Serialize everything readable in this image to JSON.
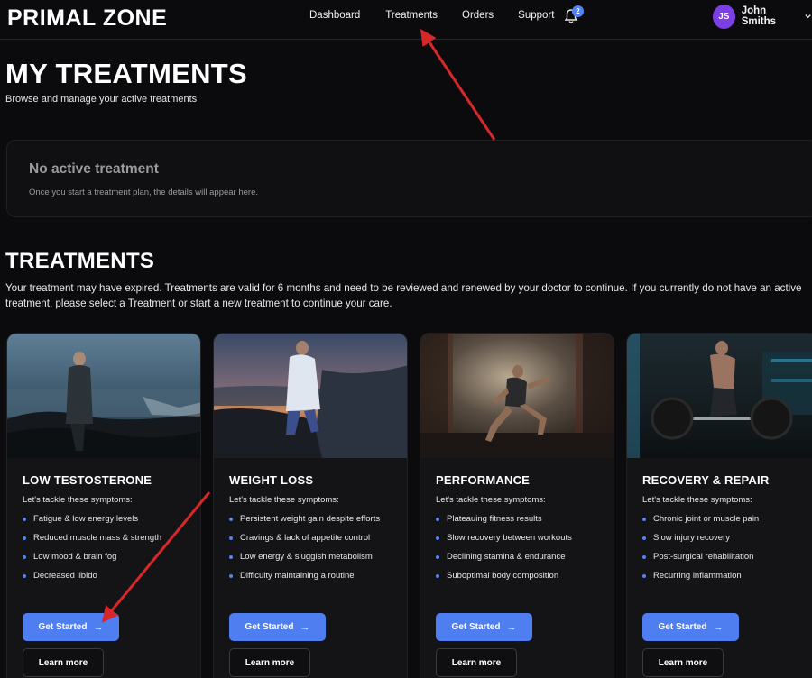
{
  "brand": {
    "logo": "PRIMAL ZONE"
  },
  "nav": {
    "links": [
      "Dashboard",
      "Treatments",
      "Orders",
      "Support"
    ],
    "notifications_count": "2",
    "user": {
      "initials": "JS",
      "name": "John Smiths"
    }
  },
  "page": {
    "title": "MY TREATMENTS",
    "subtitle": "Browse and manage your active treatments"
  },
  "empty_state": {
    "title": "No active treatment",
    "description": "Once you start a treatment plan, the details will appear here."
  },
  "treatments": {
    "title": "TREATMENTS",
    "description": "Your treatment may have expired. Treatments are valid for 6 months and need to be reviewed and renewed by your doctor to continue. If you currently do not have an active treatment, please select a Treatment or start a new treatment to continue your care.",
    "cards": [
      {
        "title": "LOW TESTOSTERONE",
        "subtitle": "Let's tackle these symptoms:",
        "symptoms": [
          "Fatigue & low energy levels",
          "Reduced muscle mass & strength",
          "Low mood & brain fog",
          "Decreased libido"
        ],
        "primary_label": "Get Started",
        "secondary_label": "Learn more"
      },
      {
        "title": "WEIGHT LOSS",
        "subtitle": "Let's tackle these symptoms:",
        "symptoms": [
          "Persistent weight gain despite efforts",
          "Cravings & lack of appetite control",
          "Low energy & sluggish metabolism",
          "Difficulty maintaining a routine"
        ],
        "primary_label": "Get Started",
        "secondary_label": "Learn more"
      },
      {
        "title": "PERFORMANCE",
        "subtitle": "Let's tackle these symptoms:",
        "symptoms": [
          "Plateauing fitness results",
          "Slow recovery between workouts",
          "Declining stamina & endurance",
          "Suboptimal body composition"
        ],
        "primary_label": "Get Started",
        "secondary_label": "Learn more"
      },
      {
        "title": "RECOVERY & REPAIR",
        "subtitle": "Let's tackle these symptoms:",
        "symptoms": [
          "Chronic joint or muscle pain",
          "Slow injury recovery",
          "Post-surgical rehabilitation",
          "Recurring inflammation"
        ],
        "primary_label": "Get Started",
        "secondary_label": "Learn more"
      }
    ]
  },
  "colors": {
    "background": "#0b0b0d",
    "card": "#141417",
    "accent": "#4f7ef0",
    "avatar": "#7b3fe4",
    "annotation_arrow": "#d62828"
  },
  "icons": [
    "bell-icon",
    "chevron-down-icon",
    "arrow-right-icon",
    "bullet-dot-icon"
  ]
}
